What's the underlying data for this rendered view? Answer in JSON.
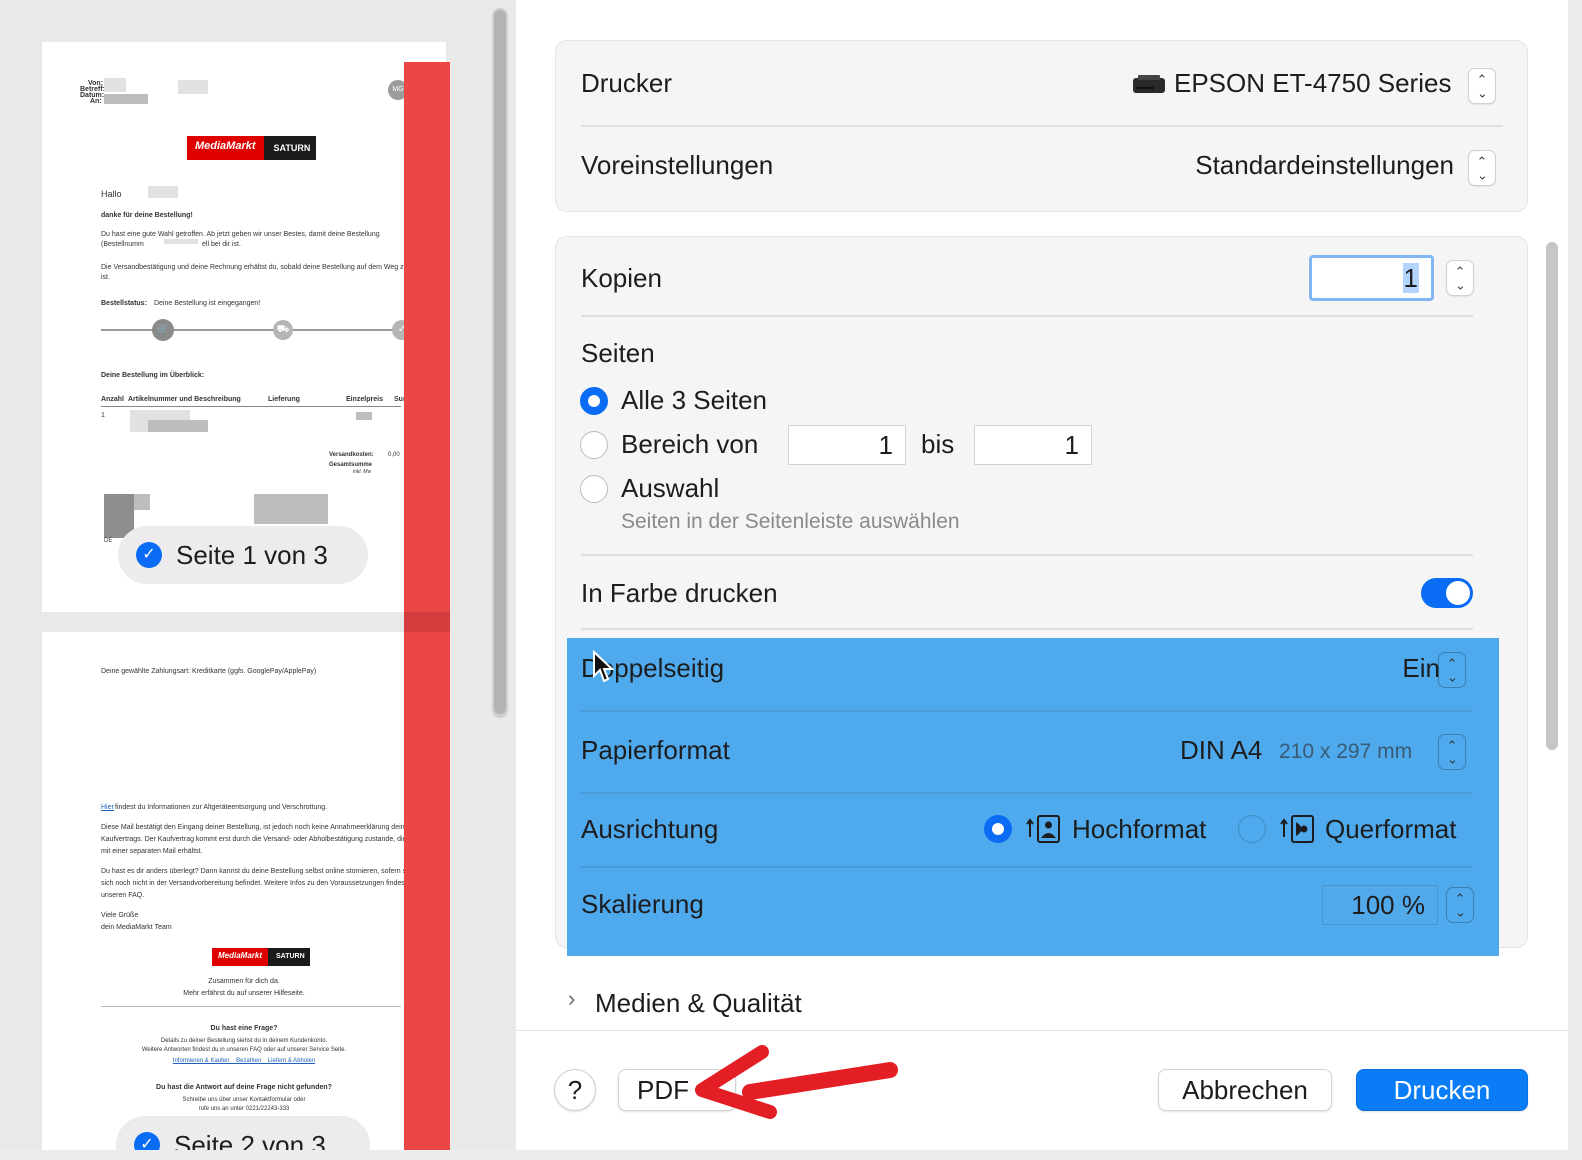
{
  "preview": {
    "page1": {
      "header_labels": [
        "Von:",
        "Betreff:",
        "Datum:",
        "An:"
      ],
      "avatar_text": "MG",
      "logo_left": "MediaMarkt",
      "logo_right": "SATURN",
      "greeting": "Hallo",
      "thanks": "danke für deine Bestellung!",
      "para1_line1": "Du hast eine gute Wahl getroffen. Ab jetzt geben wir unser Bestes, damit deine Bestellung",
      "para1_line2": "(Bestellnumm",
      "para1_line2b": "ell bei dir ist.",
      "para2_line1": "Die Versandbestätigung und deine Rechnung erhältst du, sobald deine Bestellung auf dem Weg zu",
      "para2_line2": "ist.",
      "status_label": "Bestellstatus:",
      "status_text": "Deine Bestellung ist eingegangen!",
      "overview_title": "Deine Bestellung im Überblick:",
      "table_headers": [
        "Anzahl",
        "Artikelnummer und Beschreibung",
        "Lieferung",
        "Einzelpreis",
        "Sum"
      ],
      "row_qty": "1",
      "shipping_label": "Versandkosten:",
      "shipping_value": "0,00",
      "total_label": "Gesamtsumme",
      "vat_note": "inkl. Mw",
      "footer_de": "DE",
      "badge": "Seite 1 von 3"
    },
    "page2": {
      "payment_line": "Deine gewählte Zahlungsart: Kreditkarte (ggfs. GooglePay/ApplePay)",
      "info_link": "Hier",
      "info_text": "findest du Informationen zur Altgeräteentsorgung und Verschrottung.",
      "p1": [
        "Diese Mail bestätigt den Eingang deiner Bestellung, ist jedoch noch keine Annahmeerklärung deines",
        "Kaufvertrags. Der Kaufvertrag kommt erst durch die Versand- oder Abholbestätigung zustande, die",
        "mit einer separaten Mail erhältst."
      ],
      "p2": [
        "Du hast es dir anders überlegt? Dann kannst du deine Bestellung selbst online stornieren, sofern sie",
        "sich noch nicht in der Versandvorbereitung befindet. Weitere Infos zu den Voraussetzungen findest d",
        "unseren FAQ."
      ],
      "greeting1": "Viele Grüße",
      "greeting2": "dein MediaMarkt Team",
      "logo_left": "MediaMarkt",
      "logo_right": "SATURN",
      "tagline1": "Zusammen für dich da.",
      "tagline2": "Mehr erfährst du auf unserer Hilfeseite.",
      "question_title": "Du hast eine Frage?",
      "question_l1": "Details zu deiner Bestellung siehst du in deinem Kundenkonto.",
      "question_l2": "Weitere Antworten findest du in unseren FAQ oder auf unserer Service Seite.",
      "question_links": "Informieren & Kaufen    Bezahlen    Liefern & Abholen",
      "not_found_title": "Du hast die Antwort auf deine Frage nicht gefunden?",
      "not_found_l1": "Schreibe uns über unser Kontaktformular oder",
      "not_found_l2": "rufe uns an unter 0221/22243-333",
      "badge": "Seite 2 von 3"
    }
  },
  "printer": {
    "label": "Drucker",
    "value": "EPSON ET-4750 Series",
    "icon": "printer-icon"
  },
  "presets": {
    "label": "Voreinstellungen",
    "value": "Standardeinstellungen"
  },
  "copies": {
    "label": "Kopien",
    "value": "1"
  },
  "pages": {
    "label": "Seiten",
    "all_label": "Alle 3 Seiten",
    "range_label": "Bereich von",
    "range_from": "1",
    "range_to_label": "bis",
    "range_to": "1",
    "selection_label": "Auswahl",
    "selection_hint": "Seiten in der Seitenleiste auswählen",
    "selected": "all"
  },
  "color": {
    "label": "In Farbe drucken",
    "on": true
  },
  "duplex": {
    "label": "Doppelseitig",
    "value": "Ein"
  },
  "paper": {
    "label": "Papierformat",
    "value": "DIN A4",
    "detail": "210 x 297 mm"
  },
  "orientation": {
    "label": "Ausrichtung",
    "portrait": "Hochformat",
    "landscape": "Querformat",
    "selected": "portrait"
  },
  "scale": {
    "label": "Skalierung",
    "value": "100 %"
  },
  "media_section": {
    "label": "Medien & Qualität"
  },
  "footer": {
    "help": "?",
    "pdf": "PDF",
    "cancel": "Abbrechen",
    "print": "Drucken"
  },
  "colors": {
    "accent": "#0a7cf5",
    "highlight": "#4eaaec",
    "annotation_red": "#e31e24",
    "redaction_bar": "#ec4747"
  }
}
